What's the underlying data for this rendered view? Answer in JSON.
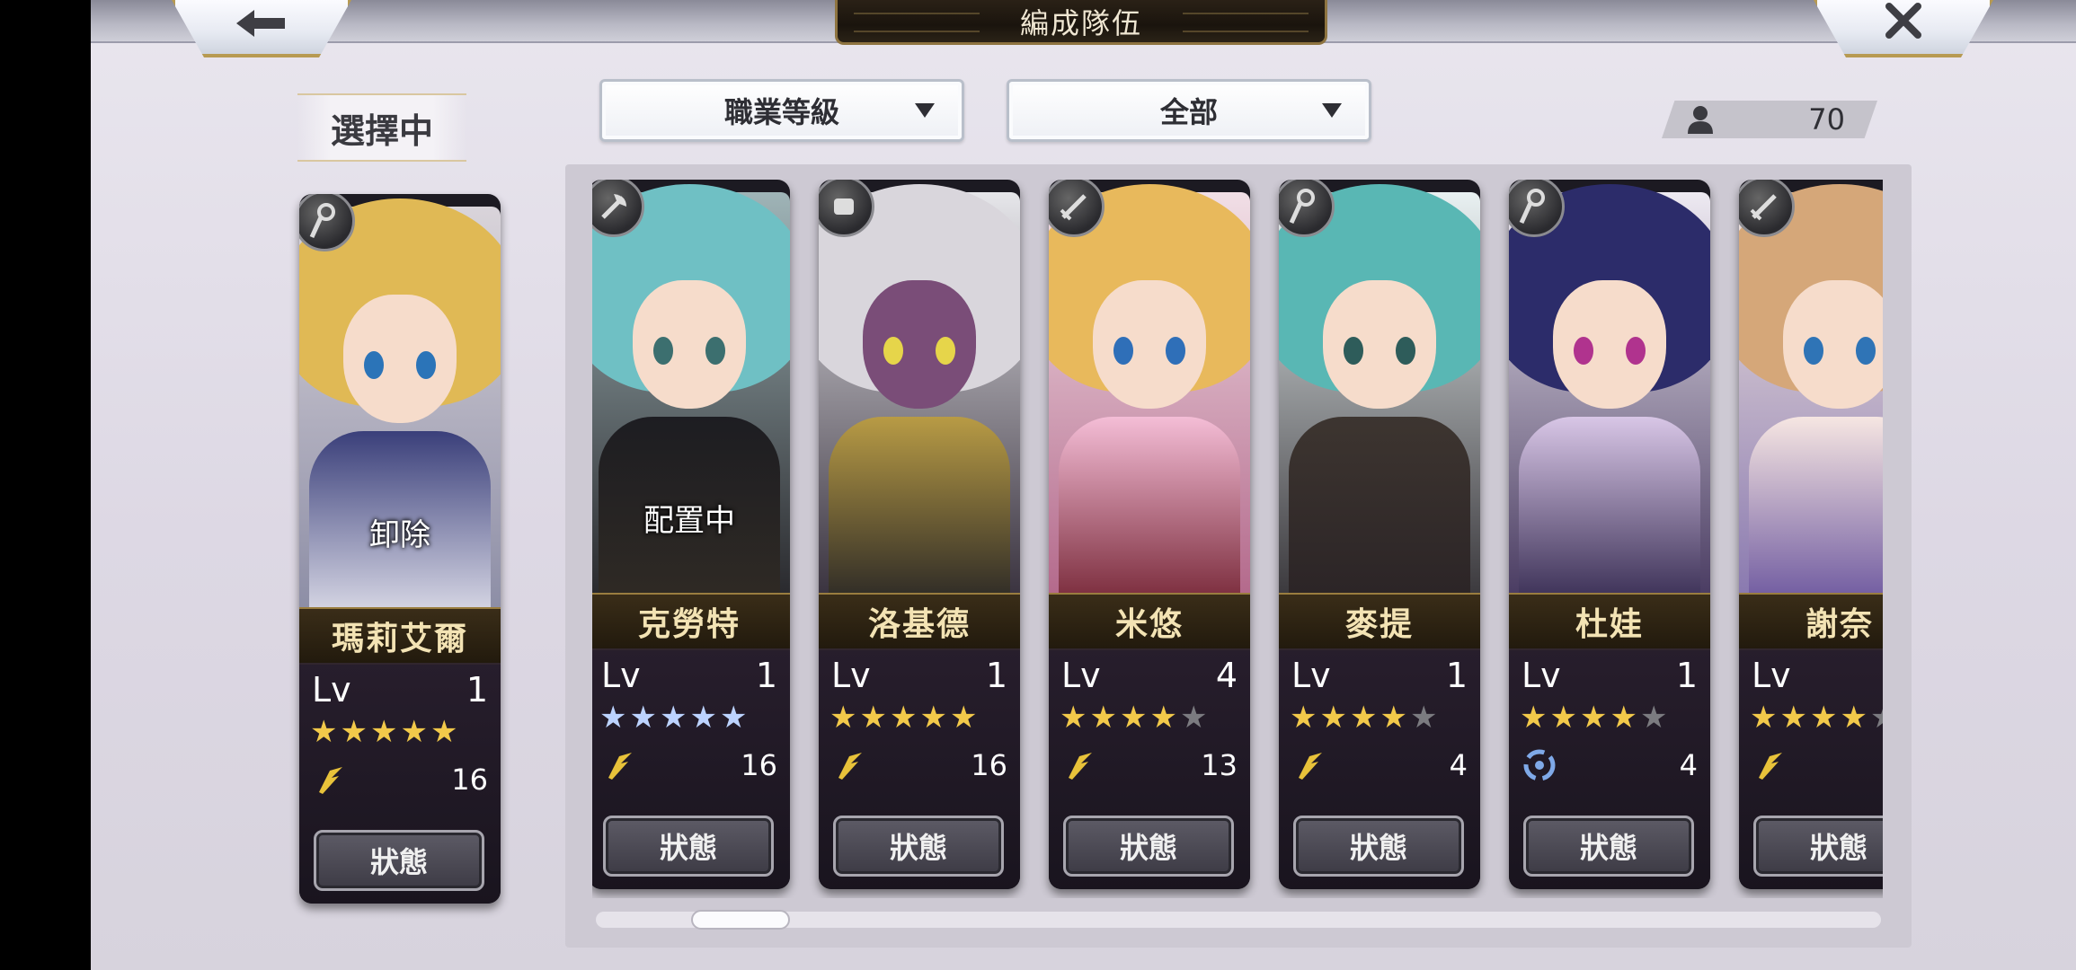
{
  "header": {
    "title": "編成隊伍"
  },
  "selecting_label": "選擇中",
  "filters": {
    "sort": "職業等級",
    "category": "全部"
  },
  "party_count": "70",
  "selected_card": {
    "name": "瑪莉艾爾",
    "overlay": "卸除",
    "level_label": "Lv",
    "level": "1",
    "stars": 5,
    "max_stars": 5,
    "element_value": "16",
    "status_label": "狀態"
  },
  "roster": [
    {
      "name": "克勞特",
      "overlay": "配置中",
      "level_label": "Lv",
      "level": "1",
      "stars": 5,
      "max_stars": 5,
      "element_value": "16",
      "status_label": "狀態",
      "star_color": "#bcd3ff"
    },
    {
      "name": "洛基德",
      "overlay": "",
      "level_label": "Lv",
      "level": "1",
      "stars": 5,
      "max_stars": 5,
      "element_value": "16",
      "status_label": "狀態"
    },
    {
      "name": "米悠",
      "overlay": "",
      "level_label": "Lv",
      "level": "4",
      "stars": 4,
      "max_stars": 5,
      "element_value": "13",
      "status_label": "狀態"
    },
    {
      "name": "麥提",
      "overlay": "",
      "level_label": "Lv",
      "level": "1",
      "stars": 4,
      "max_stars": 5,
      "element_value": "4",
      "status_label": "狀態"
    },
    {
      "name": "杜娃",
      "overlay": "",
      "level_label": "Lv",
      "level": "1",
      "stars": 4,
      "max_stars": 5,
      "element_value": "4",
      "status_label": "狀態"
    },
    {
      "name": "謝奈",
      "overlay": "",
      "level_label": "Lv",
      "level": "",
      "stars": 4,
      "max_stars": 5,
      "element_value": "",
      "status_label": "狀態"
    }
  ],
  "colors": {
    "gold_star": "#f2c94a",
    "nameplate_text": "#f3e3b4",
    "panel": "#cdc9d3"
  }
}
